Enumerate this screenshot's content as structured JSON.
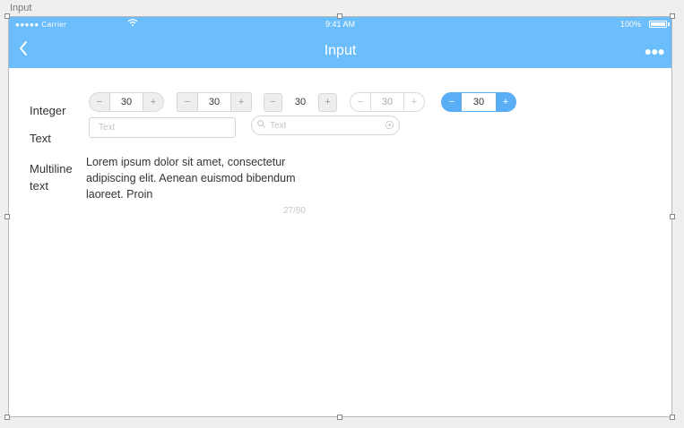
{
  "artboard": {
    "label": "Input"
  },
  "status_bar": {
    "carrier": "●●●●● Carrier",
    "wifi_icon": "wifi-icon",
    "time": "9:41 AM",
    "battery": "100%"
  },
  "navbar": {
    "back_icon": "chevron-left-icon",
    "title": "Input",
    "more_icon": "more-dots-icon",
    "more_glyph": "●●●"
  },
  "form": {
    "integer_label": "Integer",
    "text_label": "Text",
    "multiline_label_line1": "Multiline",
    "multiline_label_line2": "text",
    "steppers": [
      {
        "minus": "−",
        "value": "30",
        "plus": "+"
      },
      {
        "minus": "−",
        "value": "30",
        "plus": "+"
      },
      {
        "minus": "−",
        "value": "30",
        "plus": "+"
      },
      {
        "minus": "−",
        "value": "30",
        "plus": "+"
      },
      {
        "minus": "−",
        "value": "30",
        "plus": "+"
      }
    ],
    "text_input": {
      "placeholder": "Text",
      "value": ""
    },
    "search_input": {
      "placeholder": "Text",
      "value": ""
    },
    "multiline_text": "Lorem ipsum dolor sit amet, consectetur adipiscing elit. Aenean euismod bibendum laoreet. Proin",
    "char_counter": "27/80"
  },
  "colors": {
    "accent": "#6cbdfb",
    "stepper_active": "#5aaef5"
  }
}
